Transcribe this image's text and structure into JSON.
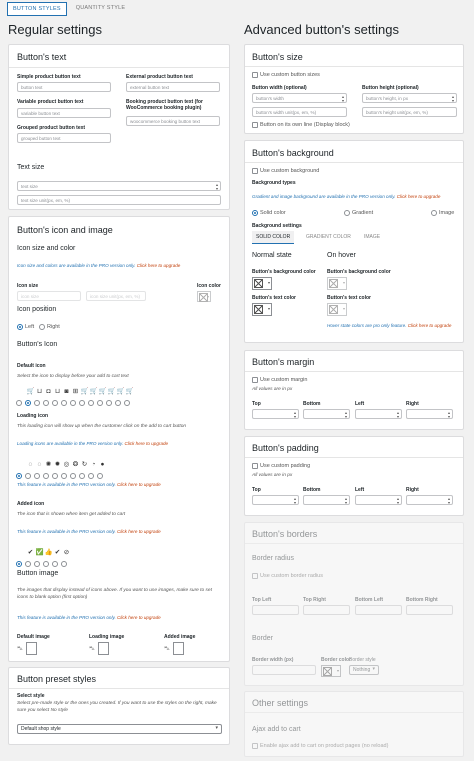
{
  "top_tabs": [
    "BUTTON STYLES",
    "QUANTITY STYLE"
  ],
  "regular": {
    "title": "Regular settings",
    "text_panel": {
      "title": "Button's text",
      "simple_label": "Simple product button text",
      "simple_ph": "button text",
      "variable_label": "Variable product button text",
      "variable_ph": "variable button text",
      "grouped_label": "Grouped product button text",
      "grouped_ph": "grouped button text",
      "external_label": "External product button text",
      "external_ph": "external button text",
      "booking_label": "Booking product button text (for WooCommerce booking plugin)",
      "booking_ph": "woocommerce booking button text",
      "size_title": "Text size",
      "size_ph": "text size",
      "size_unit_ph": "text size unit(px, em, %)"
    },
    "icon_panel": {
      "title": "Button's icon and image",
      "size_color": "Icon size and color",
      "pro_note": "Icon size and colors are available in the PRO version only.",
      "upgrade": "Click here to upgrade",
      "icon_size_label": "Icon size",
      "icon_size_ph": "icon size",
      "icon_unit_ph": "icon size unit(px, em, %)",
      "icon_color_label": "Icon color",
      "position_title": "Icon position",
      "left": "Left",
      "right": "Right",
      "buttons_icon": "Button's Icon",
      "default_icon": "Default icon",
      "default_desc": "Select the icon to display before your add to cart text",
      "loading_icon": "Loading icon",
      "loading_desc": "This loading icon will show up when the customer click on the add to cart button",
      "loading_pro": "Loading icons are available in the PRO version only.",
      "feature_pro": "This feature is available in the PRO version only.",
      "added_icon": "Added icon",
      "added_desc": "The icon that is shown when item get added to cart",
      "image_title": "Button image",
      "image_desc": "The images that display instead of icons above. If you want to use images, make sure to set icons to blank option (first option)",
      "default_image": "Default image",
      "loading_image": "Loading image",
      "added_image": "Added image"
    },
    "preset_panel": {
      "title": "Button preset styles",
      "label": "Select style",
      "desc": "Select pre-made style or the ones you created. If you want to use the styles on the right, make sure you select No style",
      "value": "Default shop style"
    }
  },
  "advanced": {
    "title": "Advanced button's settings",
    "size": {
      "title": "Button's size",
      "custom": "Use custom button sizes",
      "width_label": "Button width (optional)",
      "width_ph": "button's width",
      "width_unit_ph": "button's width unit(px, em, %)",
      "height_label": "Button height (optional)",
      "height_ph": "button's height, in px",
      "height_unit_ph": "button's height unit(px, em, %)",
      "own_line": "Button on its own line (Display block)"
    },
    "background": {
      "title": "Button's background",
      "custom": "Use custom background",
      "types": "Background types",
      "pro": "Gradient and image background are available in the PRO version only.",
      "opt1": "Solid color",
      "opt2": "Gradient",
      "opt3": "Image",
      "settings": "Background settings",
      "tabs": [
        "SOLID COLOR",
        "GRADIENT COLOR",
        "IMAGE"
      ],
      "normal": "Normal state",
      "hover": "On hover",
      "bg_color": "Button's background color",
      "text_color": "Button's text color",
      "hover_pro": "Hover state colors are pro only feature."
    },
    "margin": {
      "title": "Button's margin",
      "custom": "Use custom margin",
      "note": "All values are in px",
      "sides": [
        "Top",
        "Bottom",
        "Left",
        "Right"
      ]
    },
    "padding": {
      "title": "Button's padding",
      "custom": "Use custom padding",
      "note": "All values are in px",
      "sides": [
        "Top",
        "Bottom",
        "Left",
        "Right"
      ]
    },
    "borders": {
      "title": "Button's borders",
      "radius": "Border radius",
      "custom": "Use custom border radius",
      "corners": [
        "Top Left",
        "Top Right",
        "Bottom Left",
        "Bottom Right"
      ],
      "border": "Border",
      "width": "Border width (px)",
      "color": "Border color",
      "style": "Border style",
      "style_value": "Nothing"
    },
    "other": {
      "title": "Other settings",
      "ajax": "Ajax add to cart",
      "ajax_cb": "Enable ajax add to cart on product pages (no reload)"
    }
  },
  "colors": {
    "accent": "#2271b1",
    "upgrade": "#c2410c"
  }
}
